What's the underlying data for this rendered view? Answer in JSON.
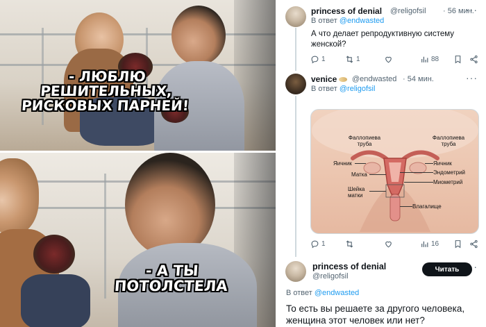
{
  "meme": {
    "caption_top": "- ЛЮБЛЮ РЕШИТЕЛЬНЫХ, РИСКОВЫХ ПАРНЕЙ!",
    "caption_bottom": "- А ТЫ ПОТОЛСТЕЛА"
  },
  "tweets": [
    {
      "name": "princess of denial",
      "handle": "@religofsil",
      "time": "· 56 мин.",
      "reply_prefix": "В ответ",
      "reply_to": "@endwasted",
      "text": "А что делает репродуктивную систему женской?",
      "counts": {
        "replies": "1",
        "retweets": "1",
        "likes": "",
        "views": "88"
      }
    },
    {
      "name": "venice",
      "handle": "@endwasted",
      "time": "· 54 мин.",
      "reply_prefix": "В ответ",
      "reply_to": "@religofsil",
      "counts": {
        "replies": "1",
        "retweets": "",
        "likes": "",
        "views": "16"
      },
      "diagram_labels": {
        "tube_left": "Фаллопиева труба",
        "tube_right": "Фаллопиева труба",
        "ovary_left": "Яичник",
        "ovary_right": "Яичник",
        "uterus": "Матка",
        "endometrium": "Эндометрий",
        "myometrium": "Миометрий",
        "cervix": "Шейка матки",
        "vagina": "Влагалище"
      }
    },
    {
      "name": "princess of denial",
      "handle": "@religofsil",
      "button": "Читать",
      "reply_prefix": "В ответ",
      "reply_to": "@endwasted",
      "text": "То есть вы решаете за другого человека, женщина этот человек или нет?"
    }
  ],
  "icons": {
    "reply": "reply-icon",
    "retweet": "retweet-icon",
    "like": "heart-icon",
    "views": "views-icon",
    "bookmark": "bookmark-icon",
    "share": "share-icon",
    "more": "more-icon"
  },
  "colors": {
    "link": "#1d9bf0",
    "text": "#0f1419",
    "muted": "#536471",
    "button_bg": "#0f1419"
  }
}
